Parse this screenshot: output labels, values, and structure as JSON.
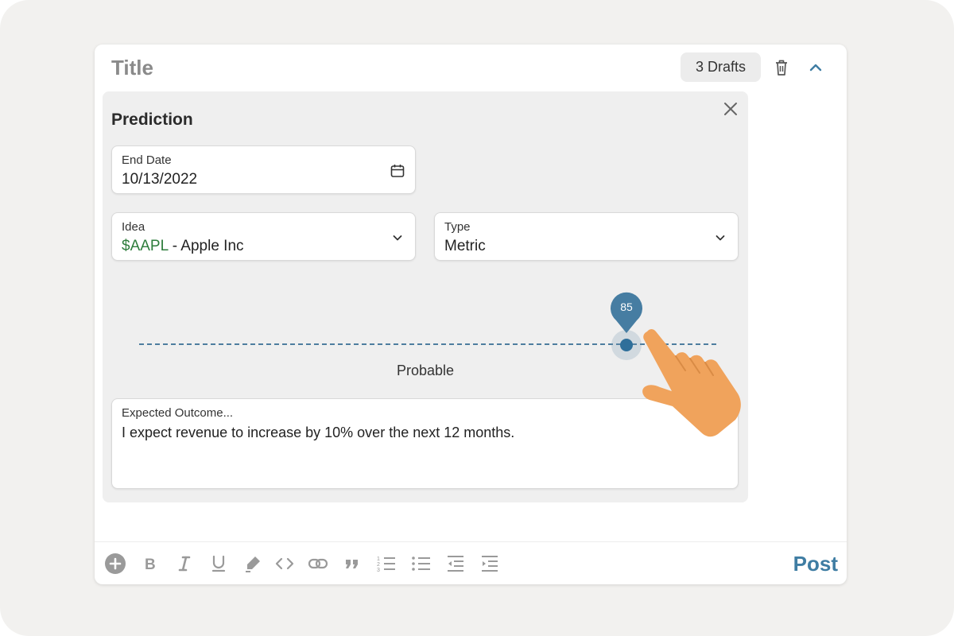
{
  "header": {
    "title": "Title",
    "drafts_label": "3 Drafts"
  },
  "prediction": {
    "title": "Prediction",
    "end_date": {
      "label": "End Date",
      "value": "10/13/2022"
    },
    "idea": {
      "label": "Idea",
      "ticker": "$AAPL",
      "name": " - Apple Inc"
    },
    "type": {
      "label": "Type",
      "value": "Metric"
    },
    "probability": {
      "value": 85,
      "label": "Probable"
    },
    "outcome": {
      "placeholder": "Expected Outcome...",
      "value": "I expect revenue to increase by 10% over the next 12 months."
    }
  },
  "toolbar": {
    "post_label": "Post",
    "icons": [
      "add-icon",
      "bold-icon",
      "italic-icon",
      "underline-icon",
      "highlight-icon",
      "code-icon",
      "link-icon",
      "quote-icon",
      "numbered-list-icon",
      "bulleted-list-icon",
      "outdent-icon",
      "indent-icon"
    ]
  },
  "colors": {
    "accent": "#3f7da3",
    "slider": "#2f6f9a",
    "ticker": "#2e7d3c",
    "hand": "#f0a35c"
  }
}
